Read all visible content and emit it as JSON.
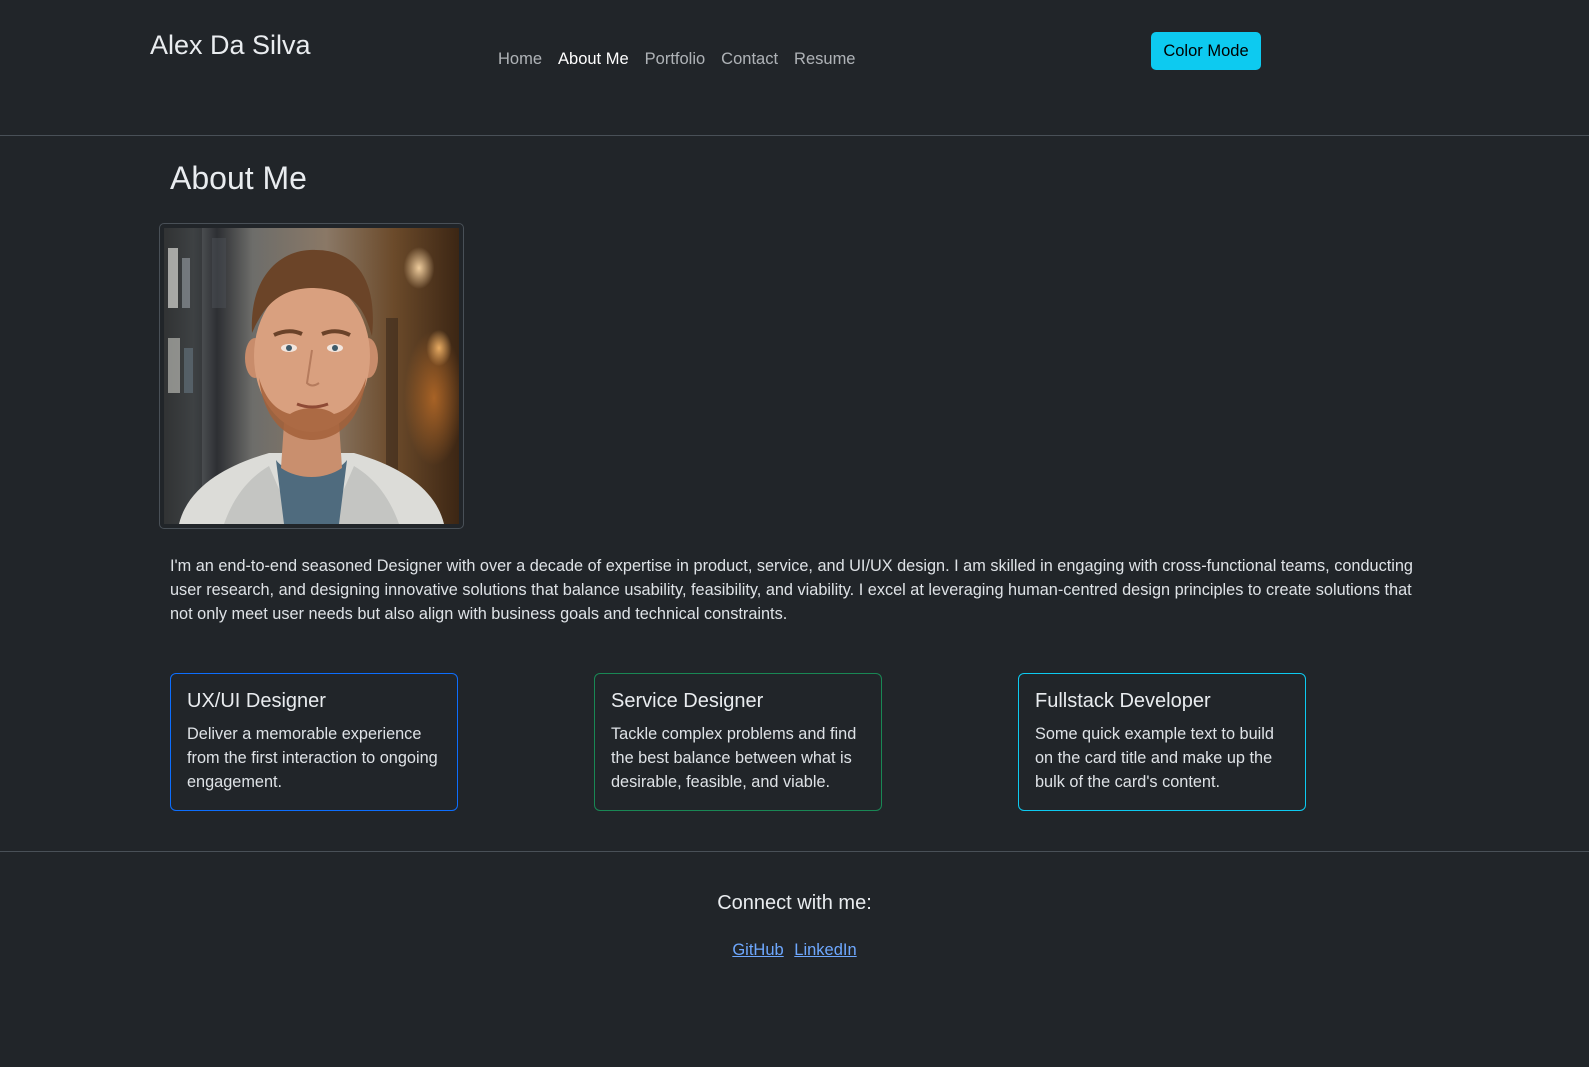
{
  "header": {
    "brand": "Alex Da Silva",
    "nav": [
      {
        "label": "Home",
        "active": false
      },
      {
        "label": "About Me",
        "active": true
      },
      {
        "label": "Portfolio",
        "active": false
      },
      {
        "label": "Contact",
        "active": false
      },
      {
        "label": "Resume",
        "active": false
      }
    ],
    "color_mode_label": "Color Mode",
    "color_mode_color": "#0dcaf0"
  },
  "main": {
    "title": "About Me",
    "bio": "I'm an end-to-end seasoned Designer with over a decade of expertise in product, service, and UI/UX design. I am skilled in engaging with cross-functional teams, conducting user research, and designing innovative solutions that balance usability, feasibility, and viability. I excel at leveraging human-centred design principles to create solutions that not only meet user needs but also align with business goals and technical constraints.",
    "cards": [
      {
        "title": "UX/UI Designer",
        "text": "Deliver a memorable experience from the first interaction to ongoing engagement.",
        "border_color": "#0d6efd"
      },
      {
        "title": "Service Designer",
        "text": "Tackle complex problems and find the best balance between what is desirable, feasible, and viable.",
        "border_color": "#198754"
      },
      {
        "title": "Fullstack Developer",
        "text": "Some quick example text to build on the card title and make up the bulk of the card's content.",
        "border_color": "#0dcaf0"
      }
    ]
  },
  "footer": {
    "title": "Connect with me:",
    "links": [
      "GitHub",
      "LinkedIn"
    ],
    "link_color": "#6ea8fe"
  },
  "colors": {
    "background": "#212529",
    "text": "#dee2e6",
    "divider": "#495057"
  }
}
